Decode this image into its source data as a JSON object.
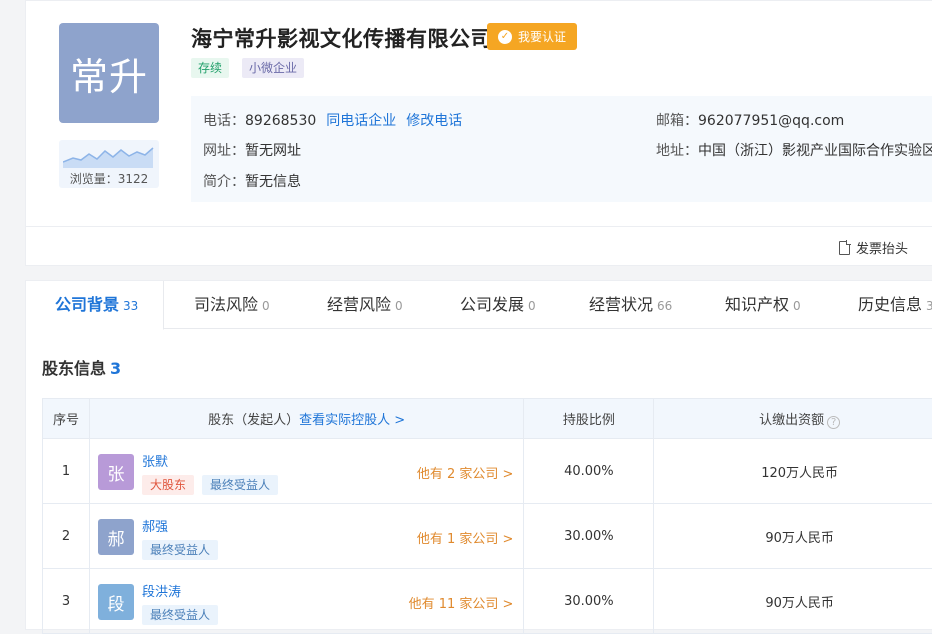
{
  "company": {
    "logo_text": "常升",
    "name": "海宁常升影视文化传播有限公司",
    "verify_label": "我要认证",
    "status_tag": "存续",
    "size_tag": "小微企业",
    "views_label": "浏览量：3122"
  },
  "contact": {
    "phone_label": "电话：",
    "phone": "89268530",
    "same_phone_link": "同电话企业",
    "edit_phone_link": "修改电话",
    "email_label": "邮箱：",
    "email": "962077951@qq.com",
    "website_label": "网址：",
    "website": "暂无网址",
    "address_label": "地址：",
    "address": "中国（浙江）影视产业国际合作实验区",
    "intro_label": "简介：",
    "intro": "暂无信息"
  },
  "invoice_label": "发票抬头",
  "tabs": [
    {
      "label": "公司背景",
      "count": "33"
    },
    {
      "label": "司法风险",
      "count": "0"
    },
    {
      "label": "经营风险",
      "count": "0"
    },
    {
      "label": "公司发展",
      "count": "0"
    },
    {
      "label": "经营状况",
      "count": "66"
    },
    {
      "label": "知识产权",
      "count": "0"
    },
    {
      "label": "历史信息",
      "count": "3"
    }
  ],
  "section": {
    "title": "股东信息",
    "count": "3"
  },
  "table": {
    "headers": {
      "index": "序号",
      "shareholder": "股东（发起人）",
      "controller_link": "查看实际控股人 >",
      "ratio": "持股比例",
      "capital": "认缴出资额",
      "capital_hint": "?"
    },
    "rows": [
      {
        "index": "1",
        "avatar": "张",
        "avatar_color": "#b89ad8",
        "name": "张默",
        "tags": [
          "大股东",
          "最终受益人"
        ],
        "more": "他有 2 家公司 >",
        "ratio": "40.00%",
        "capital": "120万人民币"
      },
      {
        "index": "2",
        "avatar": "郝",
        "avatar_color": "#8ea3cc",
        "name": "郝强",
        "tags": [
          "最终受益人"
        ],
        "more": "他有 1 家公司 >",
        "ratio": "30.00%",
        "capital": "90万人民币"
      },
      {
        "index": "3",
        "avatar": "段",
        "avatar_color": "#7fb0dc",
        "name": "段洪涛",
        "tags": [
          "最终受益人"
        ],
        "more": "他有 11 家公司 >",
        "ratio": "30.00%",
        "capital": "90万人民币"
      }
    ]
  },
  "colors": {
    "accent": "#1f75d8",
    "verify": "#f5a623",
    "status_green": "#22a06b",
    "warn_orange": "#e08a2e"
  }
}
